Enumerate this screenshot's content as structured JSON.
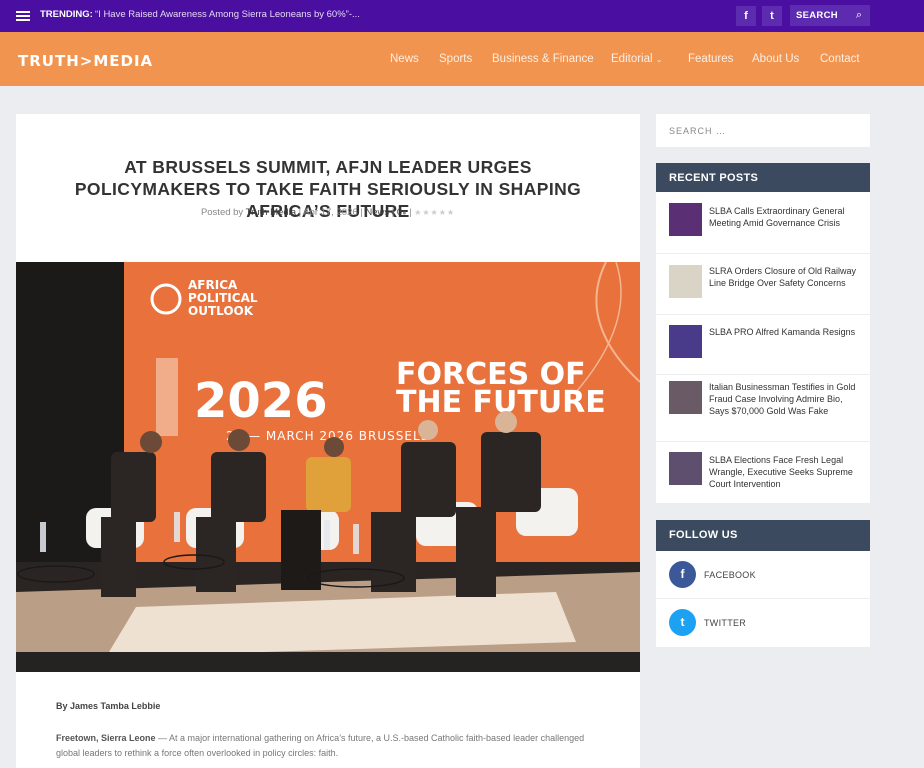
{
  "topbar": {
    "trending_label": "TRENDING:",
    "trending_text": "“I Have Raised Awareness Among Sierra Leoneans by 60%”-...",
    "facebook_glyph": "f",
    "twitter_glyph": "t",
    "search_label": "SEARCH"
  },
  "header": {
    "logo": "TRUTH>MEDIA",
    "nav": [
      "News",
      "Sports",
      "Business & Finance",
      "Editorial",
      "Features",
      "About Us",
      "Contact"
    ]
  },
  "article": {
    "title": "AT BRUSSELS SUMMIT, AFJN LEADER URGES POLICYMAKERS TO TAKE FAITH SERIOUSLY IN SHAPING AFRICA’S FUTURE",
    "meta": {
      "posted_by": "Posted by",
      "author": "Truth Media",
      "date": "Apr 17, 2026",
      "category": "News",
      "comments": "0"
    },
    "photo": {
      "brand_line1": "AFRICA",
      "brand_line2": "POLITICAL",
      "brand_line3": "OUTLOOK",
      "year": "2026",
      "headline_line1": "FORCES OF",
      "headline_line2": "THE FUTURE",
      "date_line": "26 — MARCH 2026  BRUSSELS"
    },
    "byline": "By James Tamba Lebbie",
    "dateline": "Freetown, Sierra Leone",
    "paragraph": "— At a major international gathering on Africa’s future, a U.S.-based Catholic faith-based leader challenged global leaders to rethink a force often overlooked in policy circles: faith."
  },
  "sidebar": {
    "search_placeholder": "SEARCH …",
    "recent_heading": "RECENT POSTS",
    "recent_posts": [
      {
        "title": "SLBA Calls Extraordinary General Meeting Amid Governance Crisis"
      },
      {
        "title": "SLRA Orders Closure of Old Railway Line Bridge Over Safety Concerns"
      },
      {
        "title": "SLBA PRO Alfred Kamanda Resigns"
      },
      {
        "title": "Italian Businessman Testifies in Gold Fraud Case Involving Admire Bio, Says $70,000 Gold Was Fake"
      },
      {
        "title": "SLBA Elections Face Fresh Legal Wrangle, Executive Seeks Supreme Court Intervention"
      }
    ],
    "follow_heading": "FOLLOW US",
    "follow": [
      {
        "label": "FACEBOOK",
        "glyph": "f",
        "color": "#3b5998"
      },
      {
        "label": "TWITTER",
        "glyph": "t",
        "color": "#1da1f2"
      }
    ]
  },
  "colors": {
    "topbar": "#4a0fa0",
    "header": "#f1944f",
    "widget_head": "#3b4a5e"
  }
}
